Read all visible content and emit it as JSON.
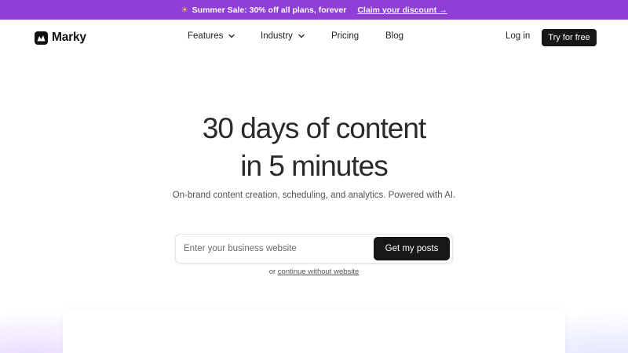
{
  "promo": {
    "icon": "sun-icon",
    "text": "Summer Sale: 30% off all plans, forever",
    "link": "Claim your discount →",
    "background": "#8e3fd6",
    "icon_color": "#ffc94d"
  },
  "nav": {
    "logo_text": "Marky",
    "items": [
      {
        "label": "Features",
        "has_dropdown": true
      },
      {
        "label": "Industry",
        "has_dropdown": true
      },
      {
        "label": "Pricing",
        "has_dropdown": false
      },
      {
        "label": "Blog",
        "has_dropdown": false
      }
    ],
    "login": "Log in",
    "cta": "Try for free"
  },
  "hero": {
    "title_line1": "30 days of content",
    "title_line2": "in 5 minutes",
    "subtitle": "On-brand content creation, scheduling, and analytics. Powered with AI."
  },
  "form": {
    "placeholder": "Enter your business website",
    "value": "",
    "button": "Get my posts"
  },
  "alt": {
    "prefix": "or",
    "link": "continue without website"
  },
  "colors": {
    "accent": "#8e3fd6",
    "button_dark": "#171717"
  }
}
